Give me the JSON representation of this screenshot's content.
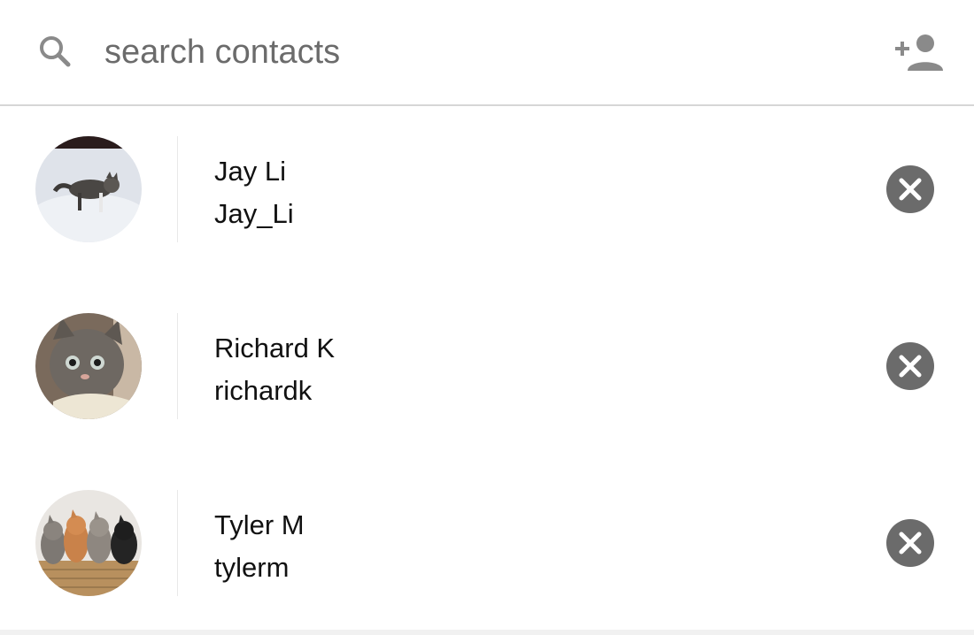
{
  "search": {
    "placeholder": "search contacts",
    "icon": "search-icon"
  },
  "header": {
    "add_contact_icon": "person-add-icon"
  },
  "contacts": [
    {
      "name": "Jay Li",
      "username": "Jay_Li",
      "avatar": "kitten-in-snow"
    },
    {
      "name": "Richard K",
      "username": "richardk",
      "avatar": "gray-tabby-kitten"
    },
    {
      "name": "Tyler M",
      "username": "tylerm",
      "avatar": "kittens-in-basket"
    }
  ],
  "colors": {
    "icon_gray": "#8a8a8a",
    "remove_button": "#6b6b6b",
    "text": "#111111",
    "divider": "#d6d6d6"
  }
}
